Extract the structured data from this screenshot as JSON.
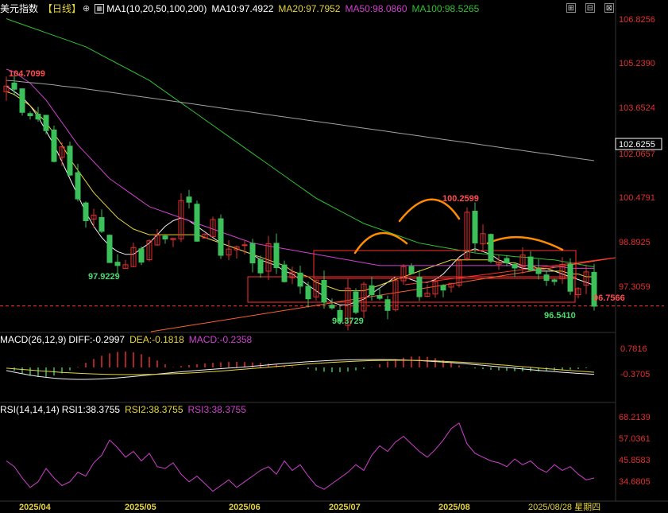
{
  "header": {
    "symbol": "美元指数",
    "period": "【日线】",
    "ma_label": "MA1(10,20,50,100,200)",
    "ma10": "MA10:97.4922",
    "ma20": "MA20:97.7952",
    "ma50": "MA50:98.0860",
    "ma100": "MA100:98.5265"
  },
  "macd_header": {
    "label": "MACD(26,12,9)",
    "diff": "DIFF:-0.2997",
    "dea": "DEA:-0.1818",
    "macd": "MACD:-0.2358"
  },
  "rsi_header": {
    "label": "RSI(14,14,14)",
    "rsi1": "RSI1:38.3755",
    "rsi2": "RSI2:38.3755",
    "rsi3": "RSI3:38.3755"
  },
  "colors": {
    "up": "#e03030",
    "down": "#3cc05a",
    "ma10": "#f0f0f0",
    "ma20": "#e6d43c",
    "ma50": "#d040d0",
    "ma100": "#30c030",
    "ma200": "#a0a0a0",
    "rsi": "#d040d0",
    "pattern": "#ff8c00"
  },
  "chart_data": [
    {
      "type": "candlestick",
      "ylim": [
        95.9,
        107.1
      ],
      "y_ticks": [
        "106.8256",
        "105.2390",
        "103.6524",
        "102.0657",
        "100.4791",
        "98.8925",
        "97.3059"
      ],
      "current_price": "102.6255",
      "annotations": {
        "high_start": "104.7099",
        "low_apr": "97.9229",
        "low_jul": "96.3729",
        "high_jul": "100.2599",
        "low_aug": "96.5410",
        "last_price": "96.7566"
      },
      "x_labels": [
        "2025/04",
        "2025/05",
        "2025/06",
        "2025/07",
        "2025/08",
        "2025/08/28 星期四"
      ],
      "series": [
        {
          "name": "MA10",
          "values": [
            104.6,
            104.4,
            104.2,
            103.9,
            103.5,
            103.0,
            102.5,
            101.9,
            101.3,
            100.7,
            100.1,
            99.6,
            99.2,
            98.9,
            98.7,
            98.6,
            98.6,
            98.8,
            99.0,
            99.3,
            99.6,
            99.8,
            99.9,
            99.8,
            99.6,
            99.4,
            99.2,
            99.0,
            98.9,
            98.8,
            98.7,
            98.6,
            98.4,
            98.3,
            98.2,
            98.0,
            97.9,
            97.7,
            97.5,
            97.3,
            97.1,
            96.9,
            96.8,
            96.8,
            96.9,
            97.0,
            97.2,
            97.4,
            97.6,
            97.8,
            97.8,
            97.7,
            97.6,
            97.6,
            97.7,
            97.9,
            98.2,
            98.5,
            98.7,
            98.8,
            98.7,
            98.6,
            98.4,
            98.3,
            98.2,
            98.1,
            98.1,
            98.0,
            98.0,
            98.0,
            97.9,
            97.8,
            97.7,
            97.6,
            97.5
          ]
        },
        {
          "name": "MA20",
          "values": [
            104.4,
            104.3,
            104.1,
            103.9,
            103.6,
            103.3,
            102.9,
            102.5,
            102.0,
            101.6,
            101.2,
            100.8,
            100.5,
            100.2,
            99.9,
            99.7,
            99.5,
            99.4,
            99.3,
            99.3,
            99.3,
            99.3,
            99.3,
            99.3,
            99.3,
            99.2,
            99.1,
            99.0,
            98.9,
            98.8,
            98.7,
            98.6,
            98.5,
            98.4,
            98.3,
            98.2,
            98.0,
            97.9,
            97.8,
            97.6,
            97.5,
            97.4,
            97.3,
            97.3,
            97.3,
            97.3,
            97.4,
            97.5,
            97.6,
            97.7,
            97.8,
            97.9,
            98.0,
            98.1,
            98.2,
            98.3,
            98.4,
            98.4,
            98.4,
            98.4,
            98.4,
            98.4,
            98.3,
            98.3,
            98.3,
            98.2,
            98.2,
            98.1,
            98.1,
            98.0,
            98.0,
            97.9,
            97.9,
            97.8,
            97.8
          ]
        },
        {
          "name": "MA50",
          "values": [
            105.2,
            105.1,
            104.9,
            104.7,
            104.4,
            104.1,
            103.7,
            103.3,
            102.9,
            102.5,
            102.2,
            101.9,
            101.6,
            101.3,
            101.1,
            100.9,
            100.7,
            100.5,
            100.3,
            100.2,
            100.1,
            100.0,
            99.9,
            99.8,
            99.7,
            99.6,
            99.5,
            99.4,
            99.3,
            99.2,
            99.1,
            99.0,
            98.95,
            98.9,
            98.85,
            98.8,
            98.75,
            98.7,
            98.65,
            98.6,
            98.55,
            98.5,
            98.45,
            98.4,
            98.35,
            98.3,
            98.25,
            98.2,
            98.2,
            98.2,
            98.2,
            98.2,
            98.2,
            98.2,
            98.2,
            98.2,
            98.2,
            98.2,
            98.2,
            98.2,
            98.2,
            98.2,
            98.2,
            98.2,
            98.2,
            98.2,
            98.2,
            98.2,
            98.2,
            98.15,
            98.15,
            98.1,
            98.1,
            98.1,
            98.1
          ]
        },
        {
          "name": "MA100",
          "values": [
            107.0,
            106.9,
            106.8,
            106.7,
            106.6,
            106.5,
            106.4,
            106.3,
            106.2,
            106.1,
            106.0,
            105.85,
            105.7,
            105.55,
            105.4,
            105.25,
            105.1,
            104.95,
            104.8,
            104.6,
            104.4,
            104.2,
            104.0,
            103.8,
            103.6,
            103.4,
            103.2,
            103.0,
            102.8,
            102.6,
            102.4,
            102.2,
            102.0,
            101.8,
            101.6,
            101.4,
            101.2,
            101.0,
            100.8,
            100.6,
            100.45,
            100.3,
            100.15,
            100.0,
            99.85,
            99.7,
            99.6,
            99.5,
            99.4,
            99.3,
            99.2,
            99.1,
            99.0,
            98.95,
            98.9,
            98.85,
            98.8,
            98.75,
            98.7,
            98.65,
            98.62,
            98.6,
            98.58,
            98.55,
            98.52,
            98.5,
            98.48,
            98.45,
            98.42,
            98.4,
            98.35,
            98.3,
            98.25,
            98.2,
            98.15
          ]
        },
        {
          "name": "MA200",
          "values": [
            104.8,
            104.78,
            104.75,
            104.72,
            104.7,
            104.67,
            104.64,
            104.6,
            104.57,
            104.54,
            104.5,
            104.46,
            104.42,
            104.38,
            104.34,
            104.3,
            104.26,
            104.22,
            104.18,
            104.14,
            104.1,
            104.06,
            104.02,
            103.98,
            103.94,
            103.9,
            103.86,
            103.82,
            103.78,
            103.74,
            103.7,
            103.66,
            103.62,
            103.58,
            103.54,
            103.5,
            103.46,
            103.42,
            103.38,
            103.34,
            103.3,
            103.26,
            103.22,
            103.18,
            103.14,
            103.1,
            103.06,
            103.02,
            102.98,
            102.94,
            102.9,
            102.86,
            102.82,
            102.78,
            102.74,
            102.7,
            102.66,
            102.62,
            102.58,
            102.54,
            102.5,
            102.46,
            102.42,
            102.38,
            102.34,
            102.3,
            102.26,
            102.22,
            102.18,
            102.14,
            102.1,
            102.06,
            102.02,
            101.98,
            101.94
          ]
        }
      ]
    },
    {
      "type": "bar",
      "name": "MACD",
      "y_ticks": [
        "0.7816",
        "-0.3705"
      ]
    },
    {
      "type": "line",
      "name": "RSI",
      "y_ticks": [
        "68.2139",
        "57.0361",
        "45.8583",
        "34.6805"
      ],
      "ylim": [
        30,
        72
      ],
      "values": [
        47,
        44,
        38,
        33,
        36,
        43,
        38,
        34,
        36,
        41,
        39,
        46,
        50,
        58,
        54,
        49,
        52,
        47,
        51,
        44,
        43,
        46,
        40,
        36,
        39,
        35,
        31,
        34,
        37,
        33,
        36,
        39,
        42,
        44,
        40,
        47,
        42,
        45,
        39,
        34,
        32,
        35,
        38,
        41,
        45,
        42,
        50,
        55,
        52,
        57,
        60,
        56,
        52,
        49,
        53,
        58,
        64,
        67,
        56,
        51,
        49,
        47,
        46,
        44,
        48,
        45,
        47,
        43,
        41,
        45,
        42,
        44,
        40,
        37,
        38
      ]
    }
  ]
}
